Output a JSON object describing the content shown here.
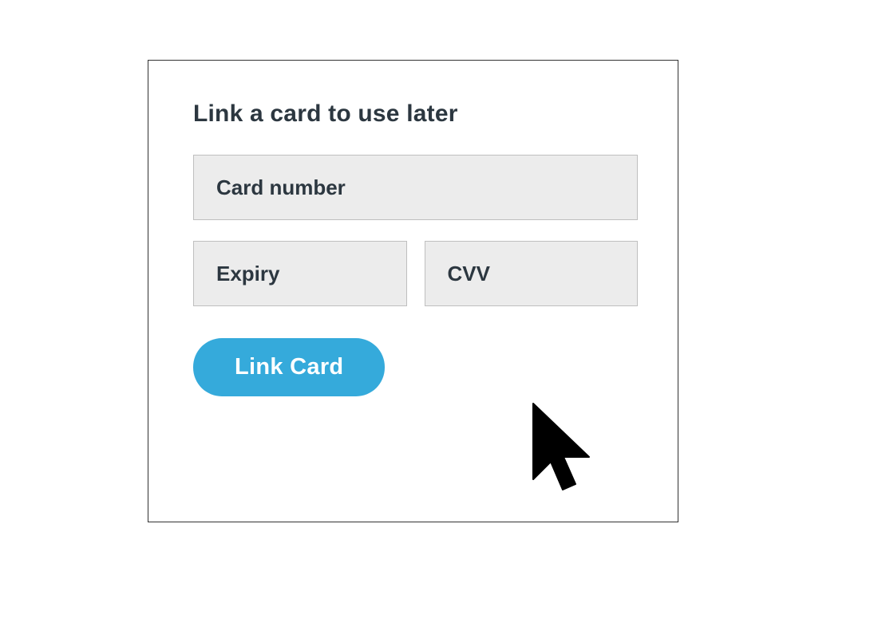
{
  "dialog": {
    "title": "Link a card to use later",
    "fields": {
      "card_number_placeholder": "Card number",
      "expiry_placeholder": "Expiry",
      "cvv_placeholder": "CVV"
    },
    "submit_label": "Link Card"
  },
  "colors": {
    "accent": "#35aadb",
    "text_dark": "#2c3740",
    "field_bg": "#ececec",
    "field_border": "#bfbfbf",
    "dialog_border": "#323232"
  }
}
